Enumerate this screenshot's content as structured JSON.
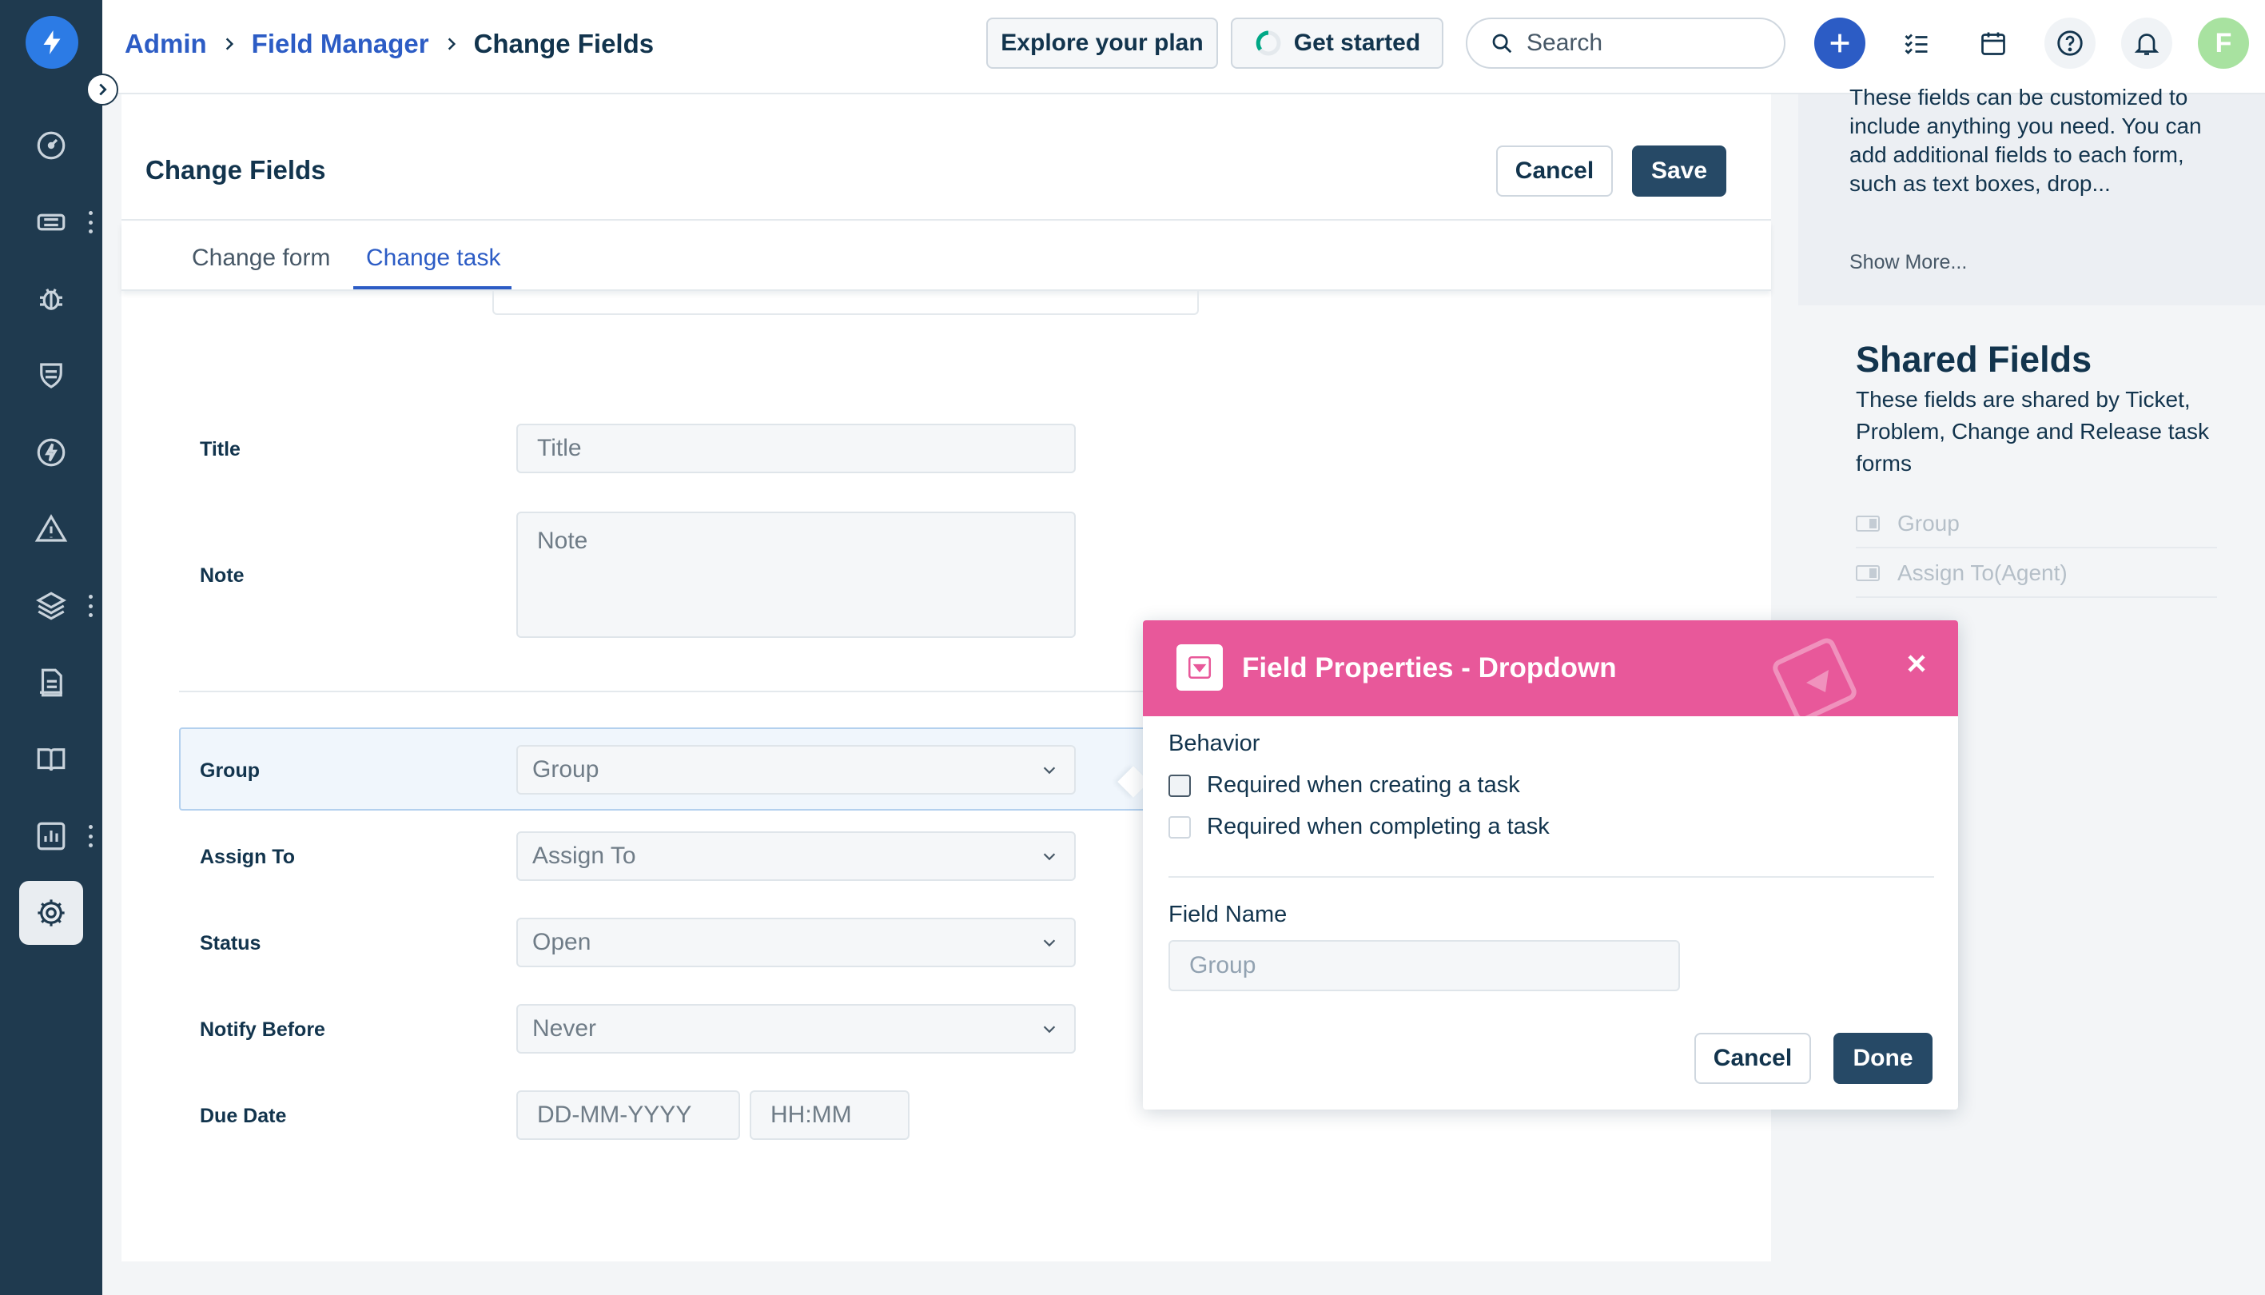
{
  "rail": {
    "items": [
      {
        "icon": "dashboard-icon"
      },
      {
        "icon": "tickets-icon"
      },
      {
        "icon": "problems-icon"
      },
      {
        "icon": "changes-icon"
      },
      {
        "icon": "releases-icon"
      },
      {
        "icon": "alerts-icon"
      },
      {
        "icon": "assets-icon"
      },
      {
        "icon": "reports-doc-icon"
      },
      {
        "icon": "solutions-icon"
      },
      {
        "icon": "analytics-icon"
      },
      {
        "icon": "admin-gear-icon"
      }
    ]
  },
  "breadcrumb": {
    "items": [
      "Admin",
      "Field Manager"
    ],
    "current": "Change Fields"
  },
  "header": {
    "explore_label": "Explore your plan",
    "get_started_label": "Get started",
    "search_placeholder": "Search",
    "avatar_initial": "F"
  },
  "card": {
    "title": "Change Fields",
    "cancel_label": "Cancel",
    "save_label": "Save",
    "tabs": [
      {
        "label": "Change form",
        "active": false
      },
      {
        "label": "Change task",
        "active": true
      }
    ]
  },
  "form": {
    "fields": [
      {
        "label": "Title",
        "value": "Title",
        "kind": "text"
      },
      {
        "label": "Note",
        "value": "Note",
        "kind": "textarea"
      },
      {
        "label": "Group",
        "value": "Group",
        "kind": "select"
      },
      {
        "label": "Assign To",
        "value": "Assign To",
        "kind": "select"
      },
      {
        "label": "Status",
        "value": "Open",
        "kind": "select"
      },
      {
        "label": "Notify Before",
        "value": "Never",
        "kind": "select"
      },
      {
        "label": "Due Date",
        "date_placeholder": "DD-MM-YYYY",
        "time_placeholder": "HH:MM",
        "kind": "datetime"
      }
    ]
  },
  "side": {
    "description": "These fields can be customized to include anything you need. You can add additional fields to each form, such as text boxes, drop...",
    "show_more": "Show More...",
    "shared_title": "Shared Fields",
    "shared_desc": "These fields are shared by Ticket, Problem, Change and Release task forms",
    "shared_items": [
      "Group",
      "Assign To(Agent)"
    ]
  },
  "modal": {
    "title": "Field Properties - Dropdown",
    "behavior_label": "Behavior",
    "options": [
      {
        "label": "Required when creating a task",
        "checked": false
      },
      {
        "label": "Required when completing a task",
        "checked": false
      }
    ],
    "field_name_label": "Field Name",
    "field_name_value": "Group",
    "cancel_label": "Cancel",
    "done_label": "Done",
    "accent": "#e8589a"
  },
  "colors": {
    "rail_bg": "#1f3a4f",
    "link": "#2c5cc5",
    "primary_btn": "#264966"
  }
}
